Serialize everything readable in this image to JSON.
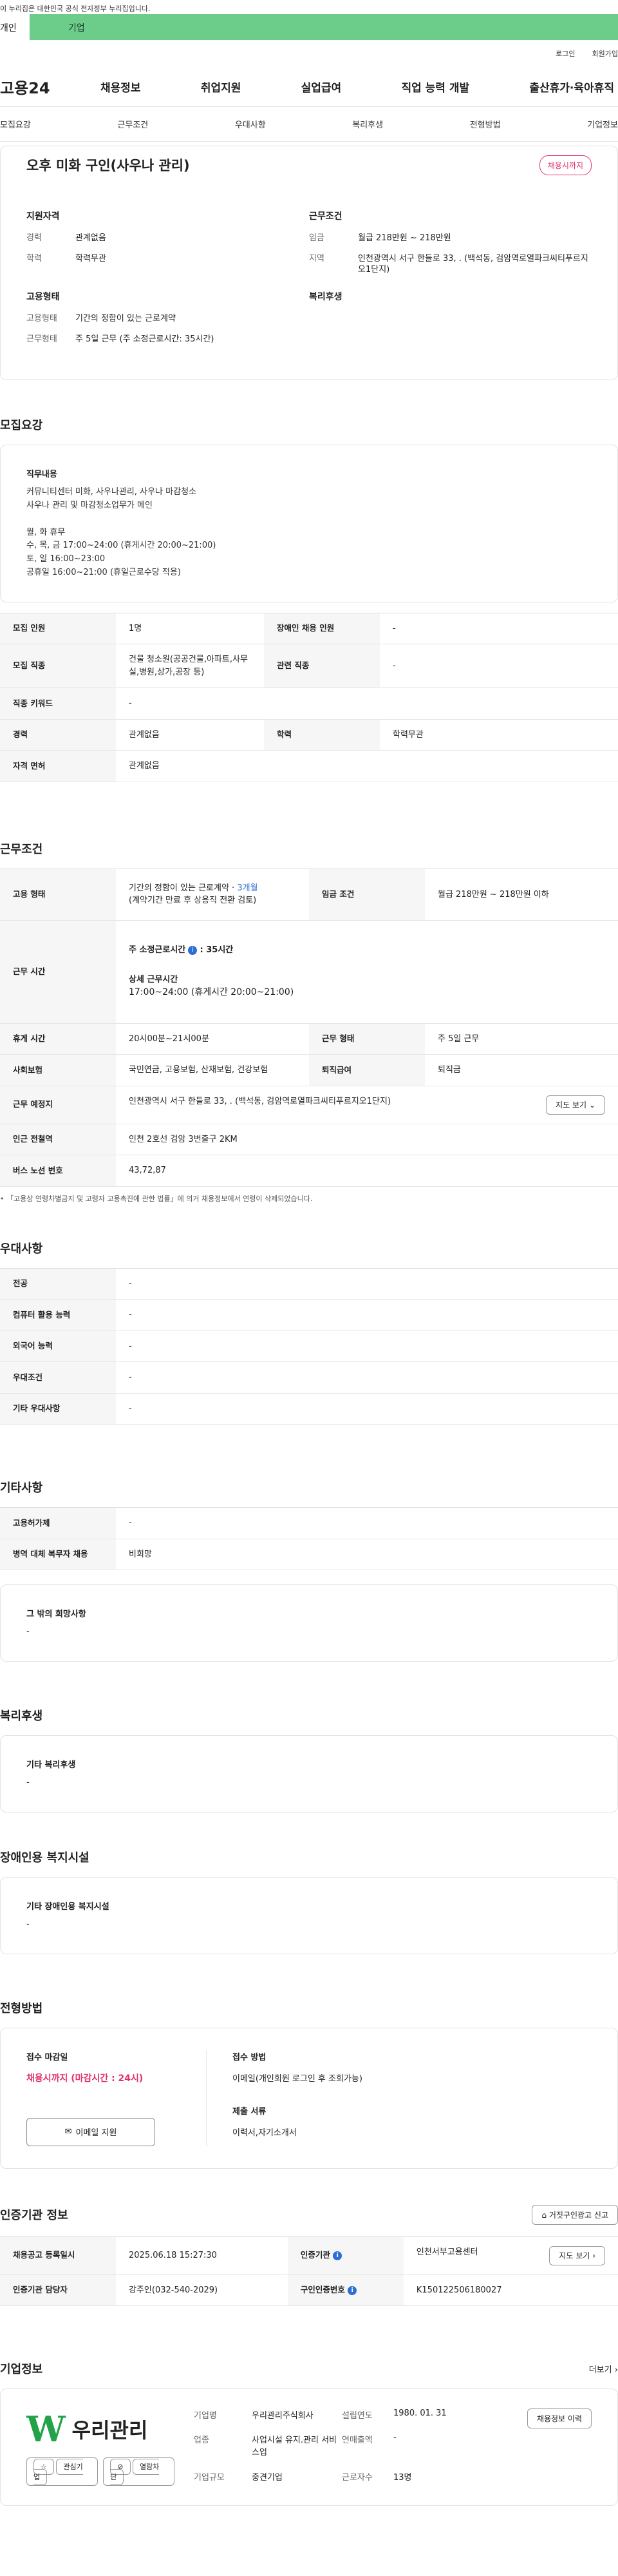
{
  "gov_banner": "이 누리집은 대한민국 공식 전자정부 누리집입니다.",
  "mode_tabs": {
    "personal": "개인",
    "biz": "기업"
  },
  "util": {
    "login": "로그인",
    "signup": "회원가입"
  },
  "logo": "고용24",
  "gnb": [
    "채용정보",
    "취업지원",
    "실업급여",
    "직업 능력 개발",
    "출산휴가·육아휴직"
  ],
  "subnav": [
    "모집요강",
    "근무조건",
    "우대사항",
    "복리후생",
    "전형방법",
    "기업정보"
  ],
  "summary": {
    "title": "오후 미화 구인(사우나 관리)",
    "badge": "채용시까지",
    "qual_title": "지원자격",
    "qual": [
      {
        "k": "경력",
        "v": "관계없음"
      },
      {
        "k": "학력",
        "v": "학력무관"
      }
    ],
    "emp_title": "고용형태",
    "emp": [
      {
        "k": "고용형태",
        "v": "기간의 정함이 있는 근로계약"
      },
      {
        "k": "근무형태",
        "v": "주 5일 근무 (주 소정근로시간: 35시간)"
      }
    ],
    "cond_title": "근무조건",
    "cond": [
      {
        "k": "임금",
        "v": "월급 218만원 ~ 218만원"
      },
      {
        "k": "지역",
        "v": "인천광역시 서구 한들로 33, . (백석동, 검암역로열파크씨티푸르지오1단지)"
      }
    ],
    "welfare_title": "복리후생"
  },
  "recruit": {
    "section": "모집요강",
    "duty_title": "직무내용",
    "duty_text": "커뮤니티센터 미화, 사우나관리, 사우나 마감청소\n사우나 관리 및 마감청소업무가 메인\n\n월, 화 휴무\n수, 목, 금 17:00~24:00 (휴게시간 20:00~21:00)\n토, 일 16:00~23:00\n공휴일 16:00~21:00 (휴일근로수당 적용)",
    "rows": [
      {
        "k1": "모집 인원",
        "v1": "1명",
        "k2": "장애인 채용 인원",
        "v2": "-"
      },
      {
        "k1": "모집 직종",
        "v1": "건물 청소원(공공건물,아파트,사무실,병원,상가,공장 등)",
        "k2": "관련 직종",
        "v2": "-"
      },
      {
        "k1": "직종 키워드",
        "v1": "-"
      },
      {
        "k1": "경력",
        "v1": "관계없음",
        "k2": "학력",
        "v2": "학력무관"
      },
      {
        "k1": "자격 면허",
        "v1": "관계없음"
      }
    ]
  },
  "work": {
    "section": "근무조건",
    "emp_k": "고용 형태",
    "emp_v_pre": "기간의 정함이 있는 근로계약 · ",
    "emp_v_hl": "3개월",
    "emp_v_sub": "(계약기간 만료 후 상용직 전환 검토)",
    "wage_k": "임금 조건",
    "wage_v": "월급 218만원 ~ 218만원 이하",
    "hours_k": "근무 시간",
    "hours_week_label": "주 소정근로시간",
    "hours_week_value": ": 35시간",
    "hours_detail_label": "상세 근무시간",
    "hours_detail_value": "17:00~24:00 (휴게시간 20:00~21:00)",
    "rest_k": "휴게 시간",
    "rest_v": "20시00분~21시00분",
    "type_k": "근무 형태",
    "type_v": "주 5일 근무",
    "ins_k": "사회보험",
    "ins_v": "국민연금, 고용보험, 산재보험, 건강보험",
    "ret_k": "퇴직급여",
    "ret_v": "퇴직금",
    "loc_k": "근무 예정지",
    "loc_v": "인천광역시 서구 한들로 33, . (백석동, 검암역로열파크씨티푸르지오1단지)",
    "map_btn": "지도 보기",
    "subway_k": "인근 전철역",
    "subway_v": "인천 2호선 검암 3번출구 2KM",
    "bus_k": "버스 노선 번호",
    "bus_v": "43,72,87",
    "note": "「고용상 연령차별금지 및 고령자 고용촉진에 관한 법률」에 의거 채용정보에서 연령이 삭제되었습니다."
  },
  "pref": {
    "section": "우대사항",
    "rows": [
      {
        "k": "전공",
        "v": "-"
      },
      {
        "k": "컴퓨터 활용 능력",
        "v": "-"
      },
      {
        "k": "외국어 능력",
        "v": "-"
      },
      {
        "k": "우대조건",
        "v": "-"
      },
      {
        "k": "기타 우대사항",
        "v": "-"
      }
    ]
  },
  "etc": {
    "section": "기타사항",
    "rows": [
      {
        "k": "고용허가제",
        "v": "-"
      },
      {
        "k": "병역 대체 복무자 채용",
        "v": "비희망"
      }
    ],
    "other_title": "그 밖의 희망사항",
    "other_value": "-"
  },
  "welfare": {
    "section": "복리후생",
    "title": "기타 복리후생",
    "value": "-"
  },
  "disabled": {
    "section": "장애인용 복지시설",
    "title": "기타 장애인용 복지시설",
    "value": "-"
  },
  "apply": {
    "section": "전형방법",
    "deadline_title": "접수 마감일",
    "deadline_value": "채용시까지 (마감시간 : 24시)",
    "mail_btn": "이메일 지원",
    "method_title": "접수 방법",
    "method_value": "이메일(개인회원 로그인 후 조회가능)",
    "docs_title": "제출 서류",
    "docs_value": "이력서,자기소개서"
  },
  "cert": {
    "section": "인증기관 정보",
    "report_btn": "거짓구인광고 신고",
    "r1": {
      "k1": "채용공고 등록일시",
      "v1": "2025.06.18 15:27:30",
      "k2": "인증기관",
      "v2": "인천서부고용센터",
      "btn": "지도 보기"
    },
    "r2": {
      "k1": "인증기관 담당자",
      "v1": "강주인(032-540-2029)",
      "k2": "구인인증번호",
      "v2": "K150122506180027"
    }
  },
  "company": {
    "section": "기업정보",
    "more": "더보기",
    "logo_text": "우리관리",
    "fav": "관심기업",
    "block": "열람차단",
    "name_k": "기업명",
    "name_v": "우리관리주식회사",
    "est_k": "설립연도",
    "est_v": "1980. 01. 31",
    "ind_k": "업종",
    "ind_v": "사업시설 유지.관리 서비스업",
    "sales_k": "연매출액",
    "sales_v": "-",
    "size_k": "기업규모",
    "size_v": "중견기업",
    "emp_k": "근로자수",
    "emp_v": "13명",
    "history_btn": "채용정보 이력"
  }
}
